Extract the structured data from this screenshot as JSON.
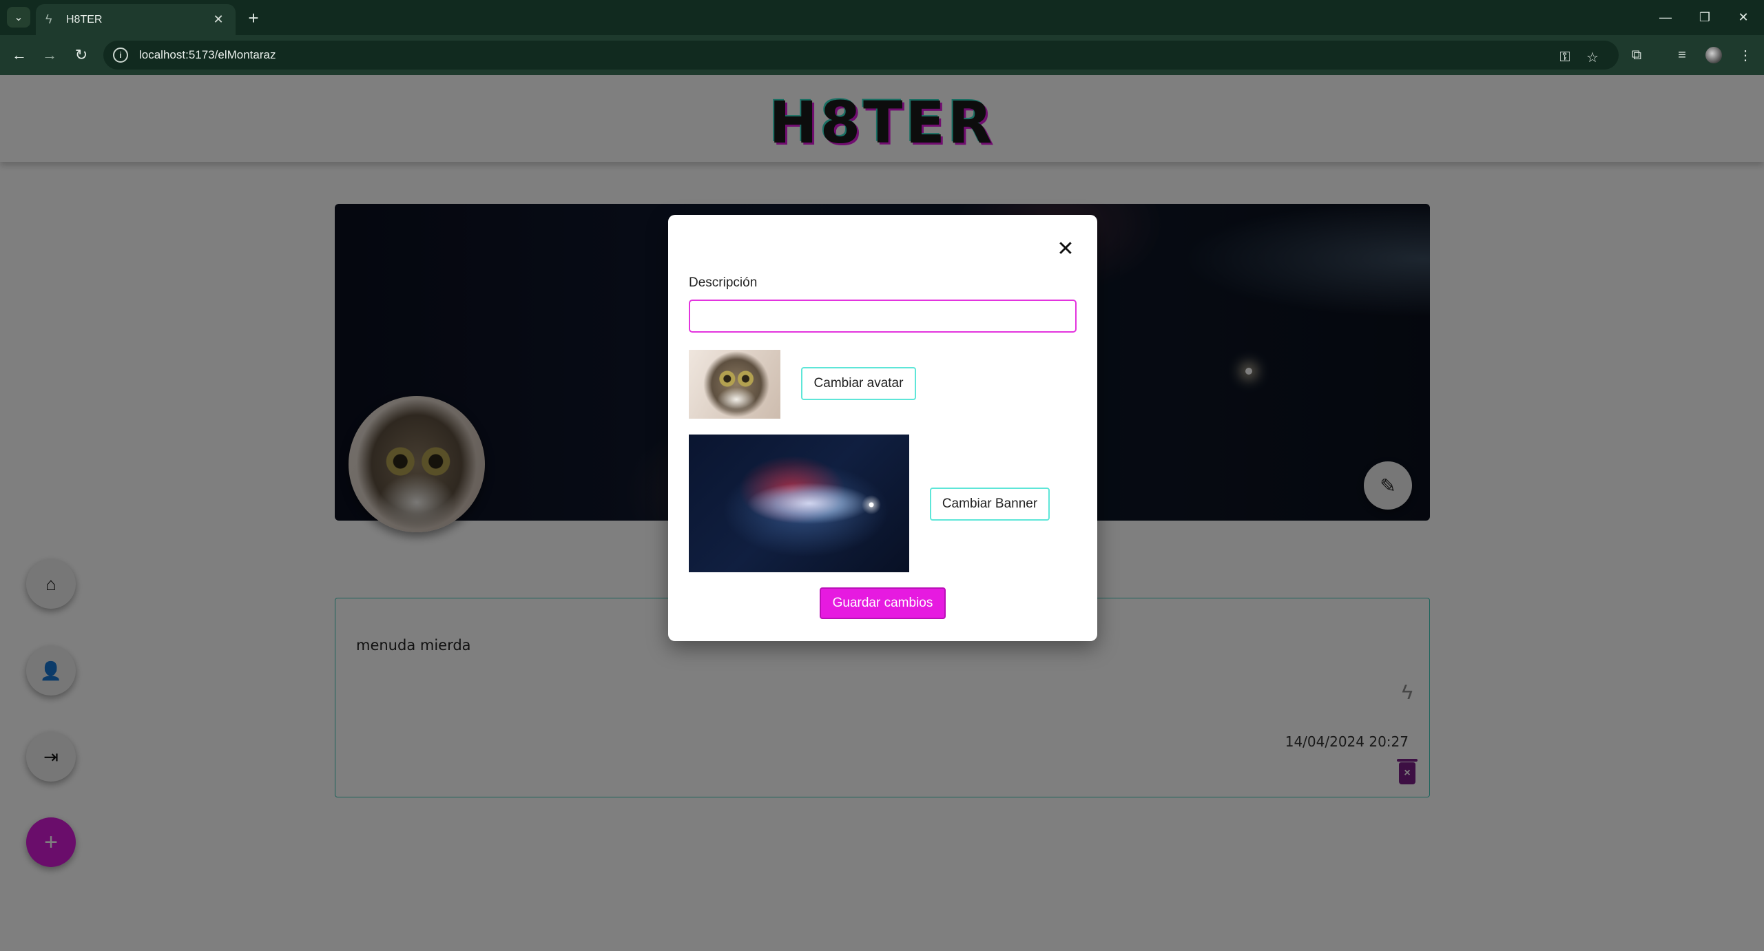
{
  "browser": {
    "tab_title": "H8TER",
    "url": "localhost:5173/elMontaraz",
    "new_tab_symbol": "+",
    "icons": [
      "tab-search-icon",
      "favicon-bolt-icon",
      "close-icon",
      "back-icon",
      "forward-icon",
      "reload-icon",
      "info-icon",
      "password-key-icon",
      "star-icon",
      "extensions-icon",
      "media-icon",
      "profile-icon",
      "menu-icon",
      "minimize-icon",
      "restore-icon",
      "window-close-icon"
    ]
  },
  "app": {
    "logo": "H8TER",
    "post": {
      "text": "menuda mierda",
      "date": "14/04/2024 20:27"
    }
  },
  "modal": {
    "description_label": "Descripción",
    "description_value": "",
    "change_avatar_label": "Cambiar avatar",
    "change_banner_label": "Cambiar Banner",
    "save_label": "Guardar cambios"
  },
  "colors": {
    "accent_pink": "#e61ae0",
    "accent_teal": "#5ee6d8",
    "chrome_dark": "#112a1f",
    "chrome_mid": "#1e3a2d"
  }
}
